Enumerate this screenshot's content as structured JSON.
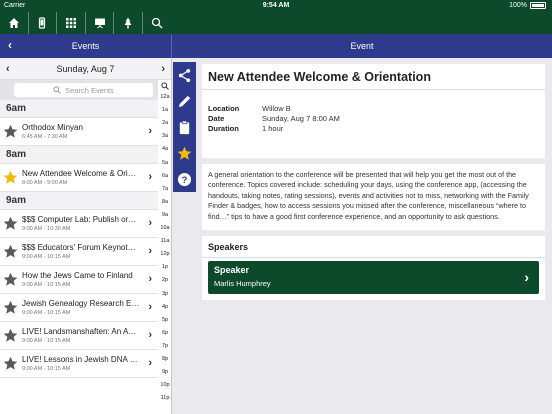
{
  "status_bar": {
    "carrier": "Carrier",
    "time": "9:54 AM",
    "battery": "100%"
  },
  "toolbar": {
    "icons": [
      "home-icon",
      "phone-icon",
      "grid-icon",
      "presentation-icon",
      "tree-icon",
      "search-icon"
    ]
  },
  "header": {
    "left_title": "Events",
    "right_title": "Event"
  },
  "date_nav": {
    "date": "Sunday, Aug 7"
  },
  "search": {
    "placeholder": "Search Events"
  },
  "hour_index": [
    "12a",
    "1a",
    "2a",
    "3a",
    "4a",
    "5a",
    "6a",
    "7a",
    "8a",
    "9a",
    "10a",
    "11a",
    "12p",
    "1p",
    "2p",
    "3p",
    "4p",
    "5p",
    "6p",
    "7p",
    "8p",
    "9p",
    "10p",
    "11p"
  ],
  "sections": [
    {
      "header": "6am",
      "events": [
        {
          "title": "Orthodox Minyan",
          "time": "6:45 AM - 7:30 AM",
          "starred": false
        }
      ]
    },
    {
      "header": "8am",
      "events": [
        {
          "title": "New Attendee Welcome & Orie…",
          "time": "8:00 AM - 9:00 AM",
          "starred": true
        }
      ]
    },
    {
      "header": "9am",
      "events": [
        {
          "title": "$$$ Computer Lab: Publish or…",
          "time": "9:00 AM - 10:30 AM",
          "starred": false
        },
        {
          "title": "$$$ Educators' Forum Keynot…",
          "time": "9:00 AM - 10:15 AM",
          "starred": false
        },
        {
          "title": "How the Jews Came to Finland",
          "time": "9:00 AM - 10:15 AM",
          "starred": false
        },
        {
          "title": "Jewish Genealogy Research E…",
          "time": "9:00 AM - 10:15 AM",
          "starred": false
        },
        {
          "title": "LIVE! Landsmanshaften: An A…",
          "time": "9:00 AM - 10:15 AM",
          "starred": false
        },
        {
          "title": "LIVE! Lessons in Jewish DNA –…",
          "time": "9:00 AM - 10:15 AM",
          "starred": false
        }
      ]
    }
  ],
  "rail_icons": [
    "share-icon",
    "pencil-icon",
    "clipboard-icon",
    "star-icon",
    "help-icon"
  ],
  "event": {
    "title": "New Attendee Welcome & Orientation",
    "location_label": "Location",
    "location": "Willow B",
    "date_label": "Date",
    "date": "Sunday, Aug 7 8:00 AM",
    "duration_label": "Duration",
    "duration": "1 hour",
    "description": "A general orientation to the conference will be presented that will help you get the most out of the conference. Topics covered include: scheduling your days, using the conference app, (accessing the handouts, taking notes, rating sessions), events and activities not to miss, networking with the Family Finder & badges, how to access sessions you missed after the conference, miscellaneous “where to find…” tips to have a good first conference experience, and an opportunity to ask questions."
  },
  "speakers": {
    "header": "Speakers",
    "card_label": "Speaker",
    "name": "Marlis Humphrey"
  },
  "colors": {
    "green": "#0d4a2b",
    "navy": "#2e3a8c",
    "star_gold": "#f5b70f",
    "star_gray": "#5a5a5a"
  }
}
